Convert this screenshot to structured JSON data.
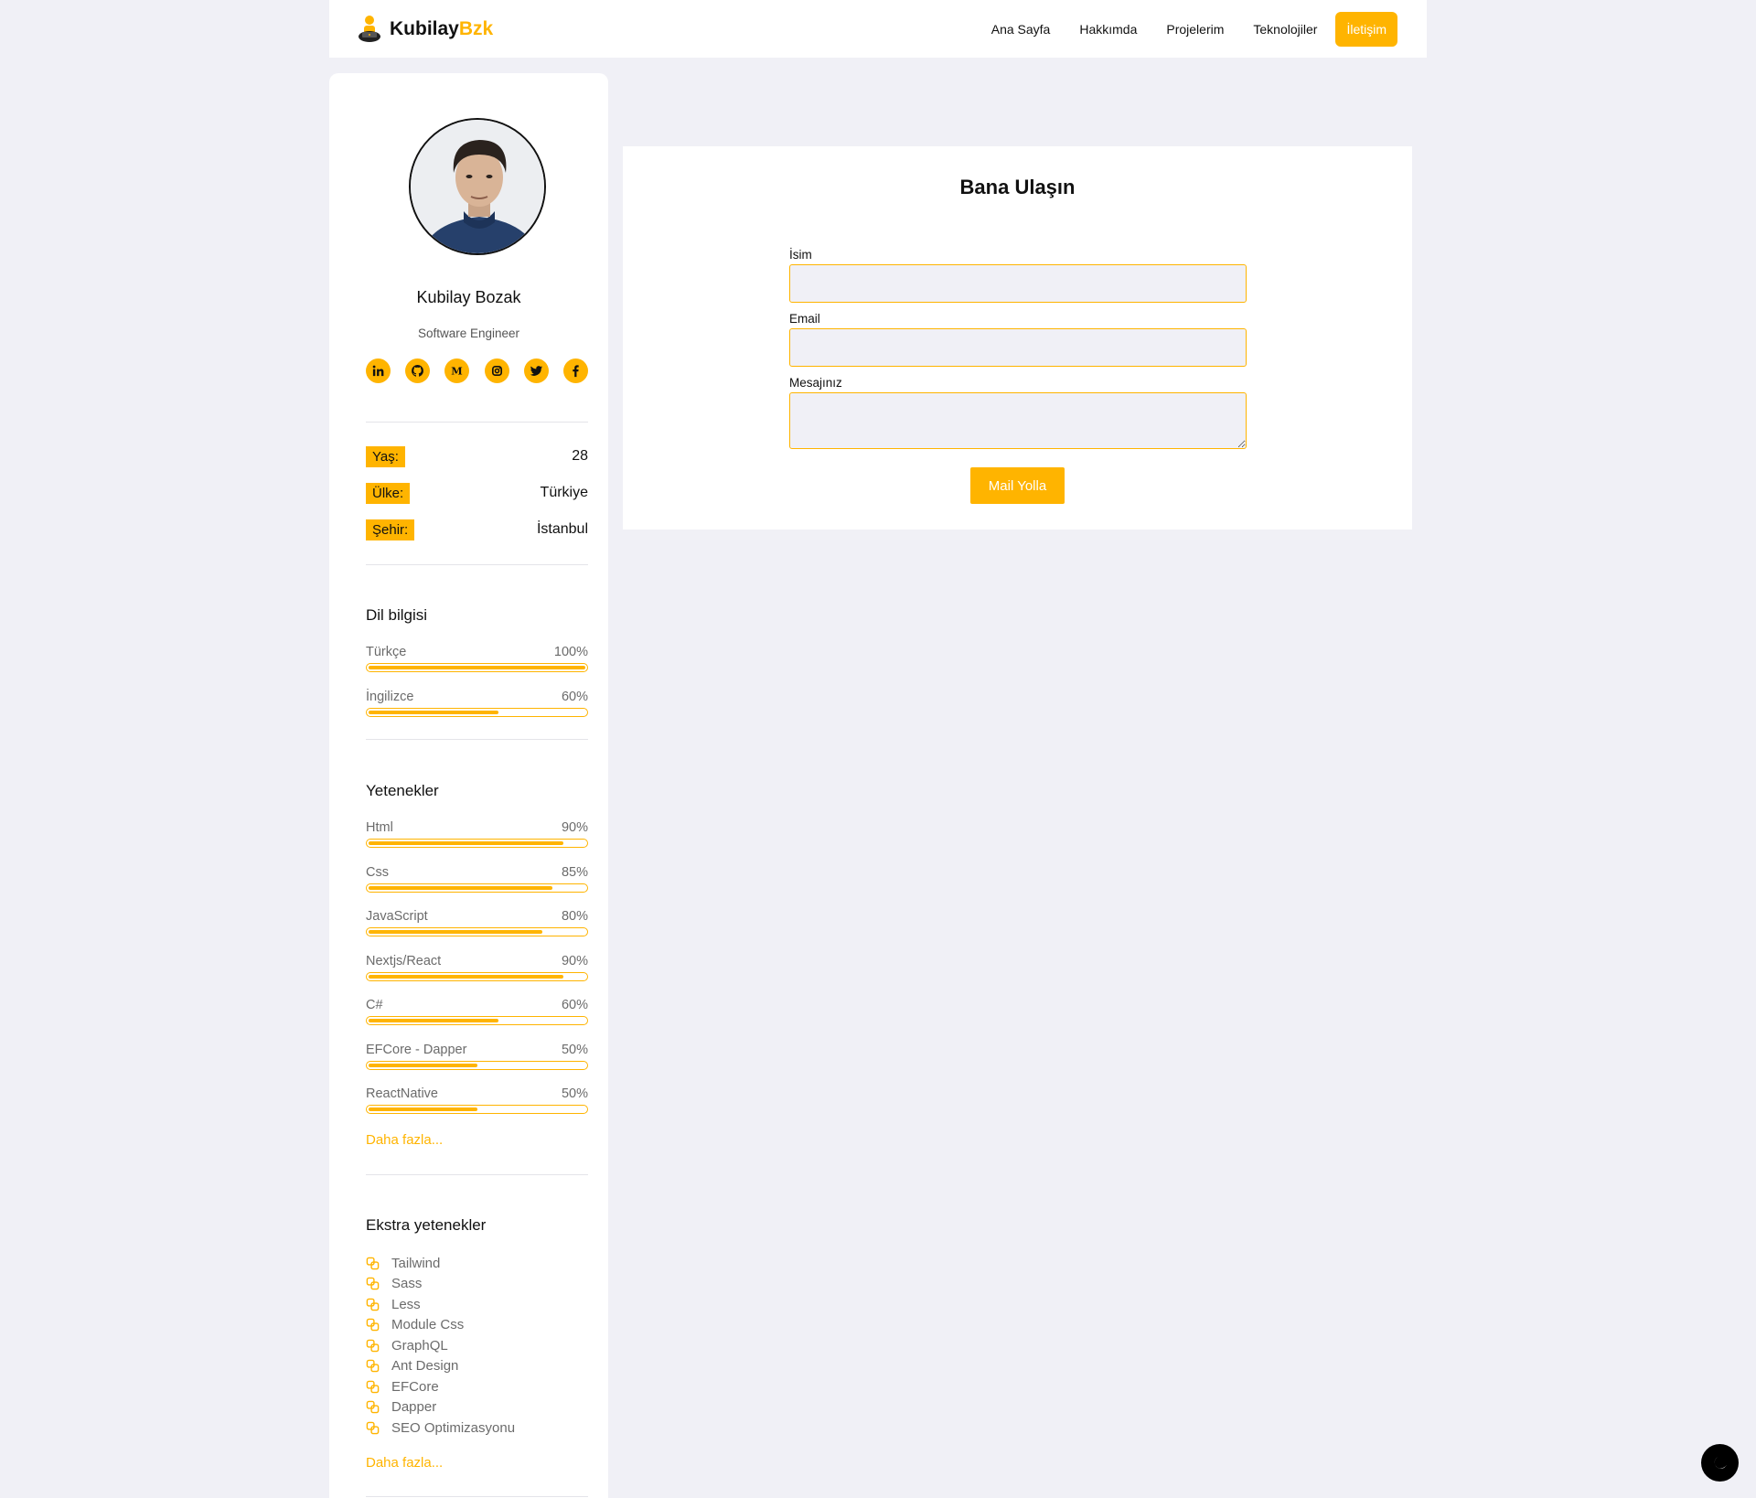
{
  "brand": {
    "name_part1": "Kubilay",
    "name_part2": "Bzk"
  },
  "nav": [
    {
      "label": "Ana Sayfa"
    },
    {
      "label": "Hakkımda"
    },
    {
      "label": "Projelerim"
    },
    {
      "label": "Teknolojiler"
    },
    {
      "label": "İletişim",
      "active": true
    }
  ],
  "profile": {
    "name": "Kubilay Bozak",
    "role": "Software Engineer",
    "socials": [
      "linkedin-icon",
      "github-icon",
      "medium-icon",
      "instagram-icon",
      "twitter-icon",
      "facebook-icon"
    ],
    "info": [
      {
        "label": "Yaş:",
        "value": "28"
      },
      {
        "label": "Ülke:",
        "value": "Türkiye"
      },
      {
        "label": "Şehir:",
        "value": "İstanbul"
      }
    ]
  },
  "languages": {
    "title": "Dil bilgisi",
    "items": [
      {
        "name": "Türkçe",
        "percent_label": "100%",
        "percent": 100
      },
      {
        "name": "İngilizce",
        "percent_label": "60%",
        "percent": 60
      }
    ]
  },
  "skills": {
    "title": "Yetenekler",
    "items": [
      {
        "name": "Html",
        "percent_label": "90%",
        "percent": 90
      },
      {
        "name": "Css",
        "percent_label": "85%",
        "percent": 85
      },
      {
        "name": "JavaScript",
        "percent_label": "80%",
        "percent": 80
      },
      {
        "name": "Nextjs/React",
        "percent_label": "90%",
        "percent": 90
      },
      {
        "name": "C#",
        "percent_label": "60%",
        "percent": 60
      },
      {
        "name": "EFCore - Dapper",
        "percent_label": "50%",
        "percent": 50
      },
      {
        "name": "ReactNative",
        "percent_label": "50%",
        "percent": 50
      }
    ],
    "more": "Daha fazla..."
  },
  "extra_skills": {
    "title": "Ekstra yetenekler",
    "items": [
      "Tailwind",
      "Sass",
      "Less",
      "Module Css",
      "GraphQL",
      "Ant Design",
      "EFCore",
      "Dapper",
      "SEO Optimizasyonu"
    ],
    "more": "Daha fazla..."
  },
  "contact": {
    "title": "Bana Ulaşın",
    "name_label": "İsim",
    "name_value": "",
    "email_label": "Email",
    "email_value": "",
    "message_label": "Mesajınız",
    "message_value": "",
    "submit_label": "Mail Yolla"
  },
  "colors": {
    "accent": "#ffb400",
    "background": "#f0f0f6",
    "card": "#ffffff"
  }
}
